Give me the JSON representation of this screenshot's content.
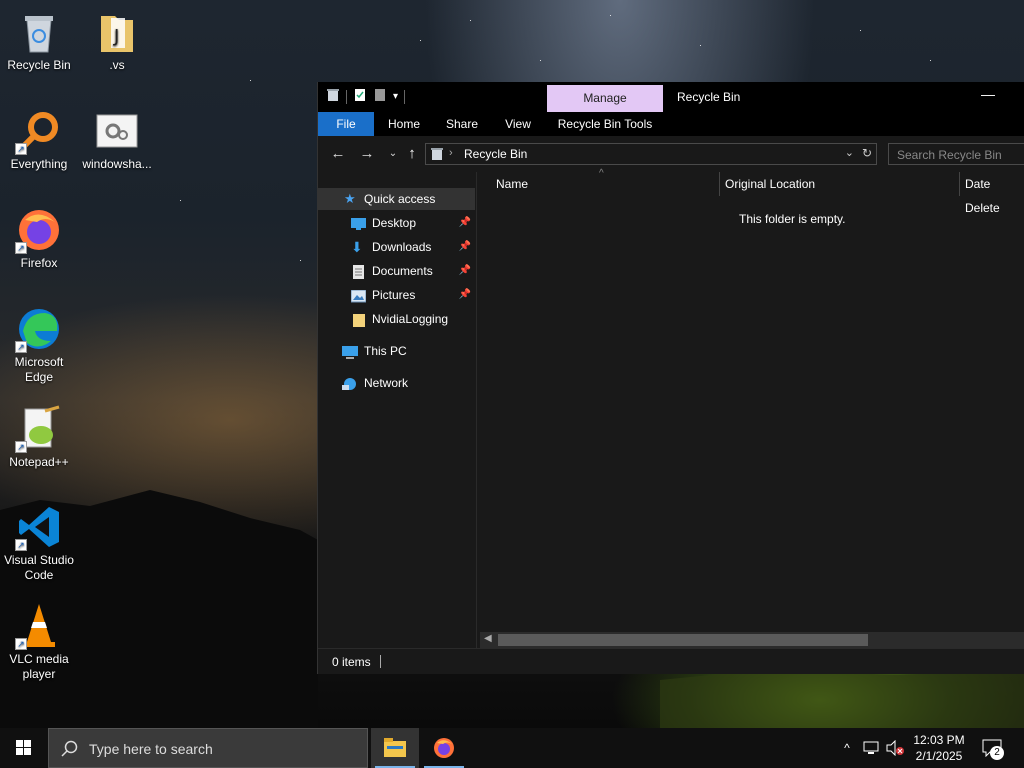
{
  "desktop": {
    "icons": [
      {
        "label": "Recycle Bin",
        "icon": "recycle-bin-icon"
      },
      {
        "label": ".vs",
        "icon": "folder-icon"
      },
      {
        "label": "Everything",
        "icon": "everything-search-icon"
      },
      {
        "label": "windowsha...",
        "icon": "settings-file-icon"
      },
      {
        "label": "Firefox",
        "icon": "firefox-icon"
      },
      {
        "label": "Microsoft Edge",
        "icon": "edge-icon"
      },
      {
        "label": "Notepad++",
        "icon": "notepadpp-icon"
      },
      {
        "label": "Visual Studio Code",
        "icon": "vscode-icon"
      },
      {
        "label": "VLC media player",
        "icon": "vlc-icon"
      }
    ]
  },
  "explorer": {
    "title": "Recycle Bin",
    "manage_tab": "Manage",
    "ribbon_tabs": [
      "File",
      "Home",
      "Share",
      "View",
      "Recycle Bin Tools"
    ],
    "address": {
      "breadcrumb": "Recycle Bin"
    },
    "search_placeholder": "Search Recycle Bin",
    "nav": {
      "quick_access": "Quick access",
      "items": [
        {
          "label": "Desktop",
          "pinned": true
        },
        {
          "label": "Downloads",
          "pinned": true
        },
        {
          "label": "Documents",
          "pinned": true
        },
        {
          "label": "Pictures",
          "pinned": true
        },
        {
          "label": "NvidiaLogging",
          "pinned": false
        }
      ],
      "this_pc": "This PC",
      "network": "Network"
    },
    "columns": [
      "Name",
      "Original Location",
      "Date Delete"
    ],
    "empty_message": "This folder is empty.",
    "status": {
      "items": "0 items"
    }
  },
  "taskbar": {
    "search_placeholder": "Type here to search",
    "time": "12:03 PM",
    "date": "2/1/2025",
    "notifications_count": "2"
  },
  "colors": {
    "accent": "#1a6fc9",
    "manage_tab": "#e3c8f5",
    "window_bg": "#191919"
  }
}
